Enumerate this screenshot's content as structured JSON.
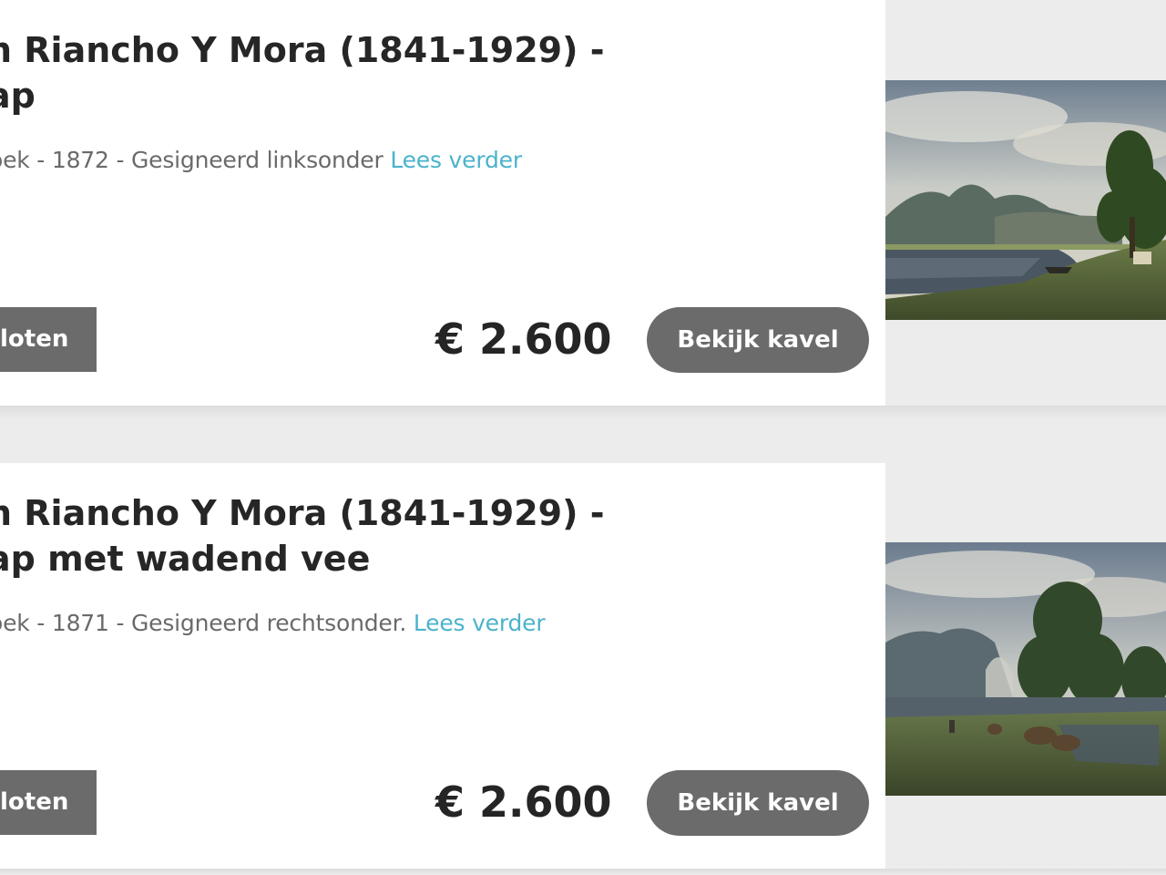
{
  "lots": [
    {
      "title_line1": "n Riancho Y Mora (1841-1929) -",
      "title_line2": "ap",
      "description": "oek - 1872 - Gesigneerd linksonder ",
      "read_more": "Lees verder",
      "closed_label": "loten",
      "price": "€ 2.600",
      "view_button": "Bekijk kavel"
    },
    {
      "title_line1": "n Riancho Y Mora (1841-1929) -",
      "title_line2": "ap met wadend vee",
      "description": "oek - 1871 - Gesigneerd rechtsonder. ",
      "read_more": "Lees verder",
      "closed_label": "loten",
      "price": "€ 2.600",
      "view_button": "Bekijk kavel"
    }
  ],
  "colors": {
    "link": "#4bb3cc",
    "button": "#6b6b6b",
    "title": "#262626",
    "description": "#6a6a6a",
    "background": "#ececec"
  },
  "icons": {
    "lot_1_image": "landscape-painting-river-boat",
    "lot_2_image": "landscape-painting-wading-cattle"
  }
}
